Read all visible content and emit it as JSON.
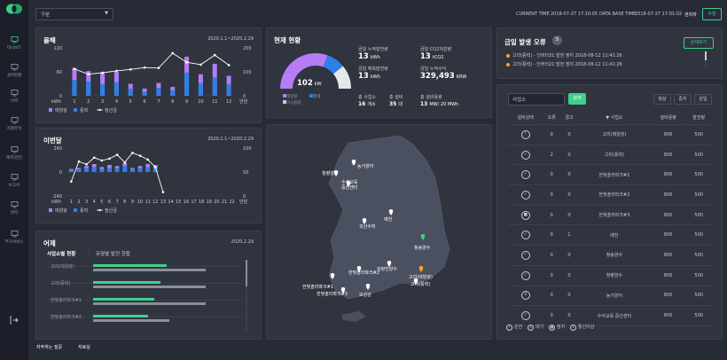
{
  "top": {
    "region_select": "구분",
    "current_time_label": "CURRENT TIME",
    "current_time": "2018-07-27 17:10:05",
    "db_time_label": "DATA BASE TIME",
    "db_time": "2018-07-27 17:01:02",
    "user": "관리자",
    "edit_button": "수정"
  },
  "sidebar": {
    "items": [
      {
        "label": "대시보드",
        "icon": "dashboard-icon"
      },
      {
        "label": "설비현황",
        "icon": "equipment-icon"
      },
      {
        "label": "이력",
        "icon": "history-icon"
      },
      {
        "label": "지원분석",
        "icon": "analysis-icon"
      },
      {
        "label": "예측/진단",
        "icon": "forecast-icon"
      },
      {
        "label": "보고서",
        "icon": "report-icon"
      },
      {
        "label": "관리",
        "icon": "settings-icon"
      },
      {
        "label": "부가서비스",
        "icon": "service-icon"
      }
    ],
    "logout_icon": "logout-icon"
  },
  "footer": {
    "faq": "자주하는 질문",
    "resources": "자료실"
  },
  "year_panel": {
    "title": "올해",
    "date": "2020.1.1~2020.2.29",
    "legend": [
      "태양광",
      "풍력",
      "정산금"
    ],
    "chart_data": {
      "type": "bar",
      "categories": [
        "1",
        "2",
        "3",
        "4",
        "5",
        "6",
        "7",
        "8",
        "9",
        "10",
        "11",
        "12"
      ],
      "x_unit": "kWh",
      "x_unit_right": "만원",
      "ylim_left": [
        0,
        120
      ],
      "ylim_right": [
        0,
        200
      ],
      "yticks_left": [
        "120",
        "60",
        "0"
      ],
      "yticks_right": [
        "200",
        "100",
        "0"
      ],
      "series": [
        {
          "name": "태양광",
          "values": [
            70,
            62,
            58,
            60,
            30,
            18,
            32,
            22,
            98,
            54,
            80,
            50
          ]
        },
        {
          "name": "풍력",
          "values": [
            40,
            36,
            30,
            34,
            18,
            10,
            20,
            14,
            58,
            32,
            46,
            30
          ]
        },
        {
          "name": "정산금",
          "values": [
            112,
            90,
            96,
            104,
            110,
            118,
            116,
            178,
            140,
            130,
            170,
            128
          ]
        }
      ]
    }
  },
  "month_panel": {
    "title": "이번달",
    "date": "2020.1.1~2020.2.29",
    "legend": [
      "태양광",
      "풍력",
      "정산금"
    ],
    "chart_data": {
      "type": "bar",
      "categories": [
        "1",
        "2",
        "3",
        "4",
        "5",
        "6",
        "7",
        "8",
        "9",
        "10",
        "11",
        "12",
        "13",
        "14",
        "15",
        "16",
        "17",
        "18",
        "19",
        "20",
        "21",
        "22"
      ],
      "x_unit": "kWh",
      "x_unit_right": "만원",
      "ylim_left": [
        -240,
        240
      ],
      "ylim_right": [
        0,
        100
      ],
      "yticks_left": [
        "240",
        "0",
        "-240"
      ],
      "yticks_right": [
        "100",
        "50",
        "0"
      ],
      "series": [
        {
          "name": "태양광",
          "values": [
            30,
            40,
            60,
            80,
            50,
            70,
            60,
            90,
            40,
            60,
            80,
            70,
            0,
            0,
            0,
            0,
            0,
            0,
            0,
            0,
            0,
            0
          ]
        },
        {
          "name": "풍력",
          "values": [
            20,
            30,
            40,
            50,
            30,
            40,
            40,
            60,
            30,
            40,
            50,
            45,
            0,
            0,
            0,
            0,
            0,
            0,
            0,
            0,
            0,
            0
          ]
        },
        {
          "name": "정산금",
          "values": [
            30,
            72,
            66,
            80,
            74,
            78,
            86,
            70,
            90,
            84,
            76,
            60,
            8
          ]
        }
      ]
    }
  },
  "yesterday_panel": {
    "title": "어제",
    "date": "2020.2.29",
    "tabs": [
      "사업소별 현황",
      "유형별 발전 현황"
    ],
    "rows": [
      {
        "name": "고리(대양광)",
        "a": 0.48,
        "b": 0.74
      },
      {
        "name": "고리(풍력)",
        "a": 0.44,
        "b": 0.74
      },
      {
        "name": "한빛솔라파크#1",
        "a": 0.4,
        "b": 0.74
      },
      {
        "name": "한빛솔라파크#2",
        "a": 0.36,
        "b": 0.5
      }
    ]
  },
  "current_panel": {
    "title": "현재 현황",
    "gauge_value": "102",
    "gauge_unit": "kW",
    "gauge_fraction": 0.78,
    "gauge_legend": [
      "태양광",
      "풍력",
      "미사용량"
    ],
    "stats": [
      {
        "label": "금일 누적발전량",
        "value": "13",
        "unit": "kWh"
      },
      {
        "label": "금일 CO2저감량",
        "value": "13",
        "unit": "tCO2"
      },
      {
        "label": "금일 예측발전량",
        "value": "13",
        "unit": "kWh"
      },
      {
        "label": "금일 누적수익",
        "value": "329,493",
        "unit": "KRW"
      }
    ],
    "bottom": [
      {
        "label": "총 사업소",
        "value": "16",
        "unit": "개소"
      },
      {
        "label": "총 설비",
        "value": "35",
        "unit": "대"
      },
      {
        "label": "총 설비용량",
        "value": "13",
        "unit": "MW/ 20 MWh"
      }
    ]
  },
  "map_panel": {
    "markers": [
      {
        "label": "청평양수",
        "color": "#ffffff"
      },
      {
        "label": "농가양어",
        "color": "#ffffff"
      },
      {
        "label": "수석교육\n중선센터",
        "color": "#ffffff"
      },
      {
        "label": "예천",
        "color": "#ffffff"
      },
      {
        "label": "괴산수력",
        "color": "#ffffff"
      },
      {
        "label": "청송양수",
        "color": "#3ed08a"
      },
      {
        "label": "삼량진양수",
        "color": "#ffffff"
      },
      {
        "label": "한빛솔라파크#2",
        "color": "#ffffff"
      },
      {
        "label": "한빛솔라파크#1",
        "color": "#ffffff"
      },
      {
        "label": "한빛솔라파크#3",
        "color": "#ffffff"
      },
      {
        "label": "보성강",
        "color": "#ffffff"
      },
      {
        "label": "고리(태양광)",
        "color": "#f5a623"
      },
      {
        "label": "고리(풍력)",
        "color": "#ffffff"
      }
    ]
  },
  "error_panel": {
    "title": "금일 발생 오류",
    "count": "5",
    "detail_button": "상세보기",
    "items": [
      "고리(풍력) - 인버터21 발전 정지 2018-08-12 11:41:26",
      "고리(풍력) - 인버터21 발전 정지 2018-08-12 11:41:26"
    ]
  },
  "site_panel": {
    "search_placeholder": "사업소",
    "search_button": "검색",
    "filters": [
      "정상",
      "중지",
      "원일"
    ],
    "headers": [
      "설비상태",
      "오류",
      "경고",
      "▼ 사업소",
      "설비용량",
      "발전량"
    ],
    "rows": [
      {
        "status": "!",
        "err": "0",
        "warn": "0",
        "site": "고리(태양광)",
        "cap": "800",
        "gen": "500"
      },
      {
        "status": "✓",
        "err": "2",
        "warn": "0",
        "site": "고리(풍력)",
        "cap": "800",
        "gen": "500"
      },
      {
        "status": "✓",
        "err": "0",
        "warn": "0",
        "site": "한빛솔라파크#1",
        "cap": "800",
        "gen": "500"
      },
      {
        "status": "✓",
        "err": "0",
        "warn": "0",
        "site": "한빛솔라파크#2",
        "cap": "800",
        "gen": "500"
      },
      {
        "status": "■",
        "err": "0",
        "warn": "0",
        "site": "한빛솔라파크#3",
        "cap": "800",
        "gen": "500"
      },
      {
        "status": "✓",
        "err": "0",
        "warn": "1",
        "site": "예천",
        "cap": "800",
        "gen": "500"
      },
      {
        "status": "✓",
        "err": "0",
        "warn": "0",
        "site": "청송양수",
        "cap": "800",
        "gen": "500"
      },
      {
        "status": "✓",
        "err": "0",
        "warn": "0",
        "site": "청평양수",
        "cap": "800",
        "gen": "500"
      },
      {
        "status": "Ⅱ",
        "err": "0",
        "warn": "0",
        "site": "농가양어",
        "cap": "800",
        "gen": "500"
      },
      {
        "status": "✓",
        "err": "0",
        "warn": "0",
        "site": "수석교육 중선센터",
        "cap": "800",
        "gen": "500"
      }
    ],
    "legend": [
      "운전",
      "대기",
      "정지",
      "통신이상"
    ]
  }
}
